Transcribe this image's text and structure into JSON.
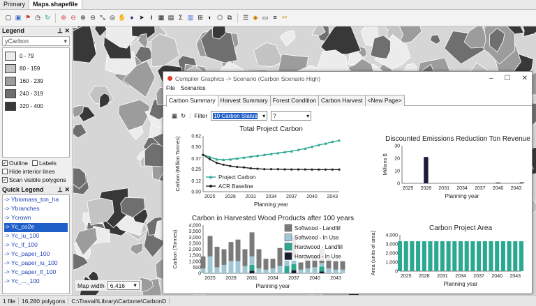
{
  "top_tabs": [
    {
      "label": "Primary",
      "active": false
    },
    {
      "label": "Maps.shapefile",
      "active": true
    }
  ],
  "toolbar_icons": [
    "new-icon",
    "save-icon",
    "flag-icon",
    "clock-icon",
    "refresh-icon",
    "zoom-in-icon",
    "zoom-out-icon",
    "zoom-in-alt-icon",
    "zoom-out-alt-icon",
    "fit-icon",
    "zoom-extent-icon",
    "pan-icon",
    "globe-icon",
    "select-icon",
    "info-icon",
    "table-icon",
    "grid-icon",
    "sum-icon",
    "chart-icon",
    "ruler-icon",
    "measure-icon",
    "identify-icon",
    "layers-icon",
    "legend-icon",
    "palette-icon",
    "properties-icon",
    "list-icon",
    "tools-icon"
  ],
  "legend": {
    "title": "Legend",
    "field": "yCarbon",
    "items": [
      {
        "label": "0 - 79",
        "color": "#ececec"
      },
      {
        "label": "80 - 159",
        "color": "#c3c3c3"
      },
      {
        "label": "160 - 239",
        "color": "#9c9c9c"
      },
      {
        "label": "240 - 319",
        "color": "#6f6f6f"
      },
      {
        "label": "320 - 400",
        "color": "#383838"
      }
    ]
  },
  "options": {
    "outline": "Outline",
    "labels": "Labels",
    "hide_interior": "Hide interior lines",
    "scan_visible": "Scan visible polygons"
  },
  "quick_legend": {
    "title": "Quick Legend",
    "items": [
      "-> Ybiomass_ton_ha",
      "-> Ybranches",
      "-> Ycrown",
      "-> Yc_co2e",
      "-> Yc_iu_100",
      "-> Yc_lf_100",
      "-> Yc_paper_100",
      "-> Yc_paper_iu_100",
      "-> Yc_paper_lf_100",
      "-> Yc_..._100"
    ],
    "selected_index": 3
  },
  "map_width": {
    "label": "Map width",
    "value": "6,416"
  },
  "status": {
    "files": "1 file",
    "polygons": "16,280 polygons",
    "path": "C:\\Travail\\Library\\Carbone\\CarbonD"
  },
  "compiler": {
    "title": "Compiler Graphics -> Scenario (Carbon Scenario High)",
    "menu": [
      "File",
      "Scenarios"
    ],
    "tabs": [
      "Carbon Summary",
      "Harvest Summary",
      "Forest Condition",
      "Carbon Harvest",
      "<New Page>"
    ],
    "active_tab": 0,
    "filter_label": "Filter",
    "filter_value": "10 Carbon Status",
    "filter_value2": "?"
  },
  "chart_data": [
    {
      "type": "line",
      "title": "Total Project Carbon",
      "xlabel": "Planning year",
      "ylabel": "Carbon (Million Tonnes)",
      "x": [
        2024,
        2025,
        2026,
        2027,
        2028,
        2029,
        2030,
        2031,
        2032,
        2033,
        2034,
        2035,
        2036,
        2037,
        2038,
        2039,
        2040,
        2041,
        2042,
        2043,
        2044
      ],
      "x_ticks": [
        2025,
        2028,
        2031,
        2034,
        2037,
        2040,
        2043
      ],
      "xlim": [
        2024,
        2044
      ],
      "y_ticks": [
        0.0,
        0.12,
        0.25,
        0.37,
        0.5,
        0.62
      ],
      "ylim": [
        0,
        0.62
      ],
      "legend_position": "bottom-left",
      "series": [
        {
          "name": "Project Carbon",
          "color": "#2aa890",
          "marker": "triangle",
          "values": [
            0.41,
            0.385,
            0.36,
            0.355,
            0.36,
            0.37,
            0.38,
            0.39,
            0.4,
            0.41,
            0.42,
            0.43,
            0.44,
            0.45,
            0.465,
            0.48,
            0.5,
            0.52,
            0.535,
            0.555,
            0.57
          ]
        },
        {
          "name": "ACR Baseline",
          "color": "#222222",
          "marker": "circle",
          "values": [
            0.41,
            0.36,
            0.32,
            0.3,
            0.285,
            0.275,
            0.27,
            0.26,
            0.255,
            0.25,
            0.25,
            0.25,
            0.248,
            0.247,
            0.247,
            0.247,
            0.246,
            0.246,
            0.246,
            0.246,
            0.246
          ]
        }
      ]
    },
    {
      "type": "bar",
      "title": "Discounted Emissions Reduction Ton Revenue",
      "xlabel": "Planning year",
      "ylabel": "Millions $",
      "x": [
        2024,
        2025,
        2026,
        2027,
        2028,
        2029,
        2030,
        2031,
        2032,
        2033,
        2034,
        2035,
        2036,
        2037,
        2038,
        2039,
        2040,
        2041,
        2042,
        2043,
        2044
      ],
      "x_ticks": [
        2025,
        2028,
        2031,
        2034,
        2037,
        2040,
        2043
      ],
      "xlim": [
        2024,
        2044
      ],
      "y_ticks": [
        0,
        10,
        20,
        30
      ],
      "ylim": [
        0,
        30
      ],
      "color": "#1c1c3c",
      "values": [
        0,
        0,
        0,
        0,
        21,
        0,
        0,
        0,
        0,
        0,
        0,
        0,
        0,
        0,
        0,
        0,
        0.6,
        0,
        0,
        0,
        0.7
      ]
    },
    {
      "type": "bar",
      "stacked": true,
      "title": "Carbon in Harvested Wood Products after 100 years",
      "xlabel": "Planning year",
      "ylabel": "Carbon (Tonnes)",
      "x": [
        2024,
        2025,
        2026,
        2027,
        2028,
        2029,
        2030,
        2031,
        2032,
        2033,
        2034,
        2035,
        2036,
        2037,
        2038,
        2039,
        2040,
        2041,
        2042,
        2043,
        2044
      ],
      "x_ticks": [
        2025,
        2028,
        2031,
        2034,
        2037,
        2040,
        2043
      ],
      "xlim": [
        2024,
        2044
      ],
      "y_ticks": [
        0,
        500,
        1000,
        1500,
        2000,
        2500,
        3000,
        3500,
        4000
      ],
      "ylim": [
        0,
        4000
      ],
      "legend_position": "top-right",
      "series": [
        {
          "name": "Hardwood - In Use",
          "color": "#1a1a30",
          "values": [
            0,
            0,
            0,
            0,
            0,
            0,
            0,
            200,
            0,
            0,
            0,
            0,
            0,
            250,
            0,
            0,
            0,
            150,
            0,
            0,
            0
          ]
        },
        {
          "name": "Hardwood - Landfill",
          "color": "#2aa890",
          "values": [
            0,
            0,
            0,
            0,
            0,
            0,
            0,
            500,
            0,
            0,
            0,
            0,
            600,
            500,
            0,
            0,
            0,
            400,
            0,
            0,
            0
          ]
        },
        {
          "name": "Softwood - In Use",
          "color": "#9fc7d6",
          "values": [
            400,
            1400,
            500,
            700,
            1000,
            1000,
            600,
            700,
            400,
            300,
            400,
            600,
            1200,
            600,
            300,
            400,
            500,
            300,
            400,
            300,
            300
          ]
        },
        {
          "name": "Softwood - Landfill",
          "color": "#7a7a7a",
          "values": [
            1000,
            1700,
            1700,
            1300,
            1600,
            1800,
            1400,
            2000,
            1600,
            900,
            800,
            1500,
            1400,
            1700,
            600,
            800,
            900,
            1200,
            800,
            700,
            700
          ]
        }
      ]
    },
    {
      "type": "bar",
      "title": "Carbon Project Area",
      "xlabel": "Planning year",
      "ylabel": "Area (units of area)",
      "x": [
        2024,
        2025,
        2026,
        2027,
        2028,
        2029,
        2030,
        2031,
        2032,
        2033,
        2034,
        2035,
        2036,
        2037,
        2038,
        2039,
        2040,
        2041,
        2042,
        2043,
        2044
      ],
      "x_ticks": [
        2025,
        2028,
        2031,
        2034,
        2037,
        2040,
        2043
      ],
      "xlim": [
        2024,
        2044
      ],
      "y_ticks": [
        0,
        1000,
        2000,
        3000,
        4000
      ],
      "ylim": [
        0,
        4000
      ],
      "color": "#2aa890",
      "values": [
        3300,
        3300,
        3300,
        3300,
        3300,
        3300,
        3300,
        3300,
        3300,
        3300,
        3300,
        3300,
        3300,
        3300,
        3300,
        3300,
        3300,
        3300,
        3300,
        3300,
        3300
      ]
    }
  ]
}
